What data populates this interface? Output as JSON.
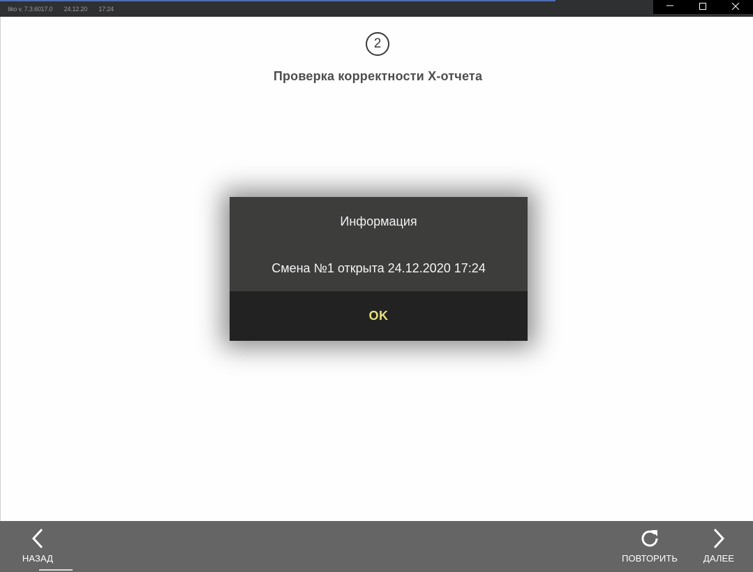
{
  "titlebar": {
    "app_version": "Iiko v. 7.3.6017.0",
    "date": "24.12.20",
    "time": "17:24"
  },
  "window_controls": {
    "minimize": "minimize-icon",
    "maximize": "maximize-icon",
    "close": "close-icon"
  },
  "step": {
    "number": "2",
    "title": "Проверка корректности Х-отчета"
  },
  "dialog": {
    "title": "Информация",
    "message": "Смена №1 открыта 24.12.2020 17:24",
    "ok_label": "OK"
  },
  "bottombar": {
    "back_label": "НАЗАД",
    "repeat_label": "ПОВТОРИТЬ",
    "next_label": "ДАЛЕЕ"
  },
  "colors": {
    "dialog_body": "#3d3e3c",
    "dialog_footer": "#222222",
    "ok_text": "#e7e07d",
    "bottombar": "#656565",
    "titlebar": "#2f3032"
  }
}
